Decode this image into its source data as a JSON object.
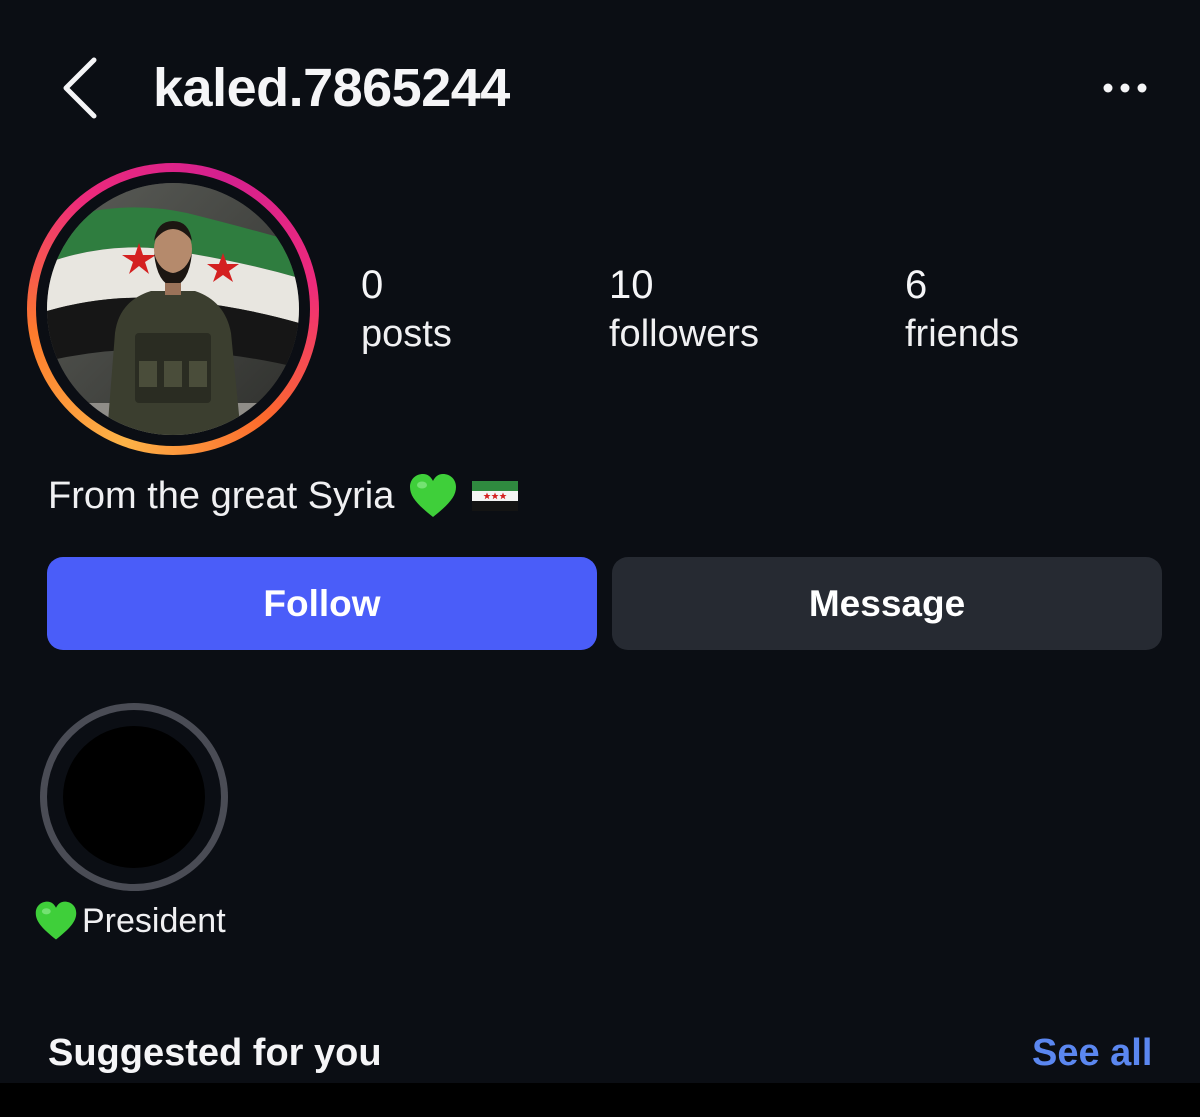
{
  "header": {
    "username": "kaled.7865244",
    "back_icon": "chevron-left-icon",
    "more_icon": "more-horizontal-icon"
  },
  "stats": [
    {
      "value": "0",
      "label": "posts"
    },
    {
      "value": "10",
      "label": "followers"
    },
    {
      "value": "6",
      "label": "friends"
    }
  ],
  "bio": {
    "text": "From the great Syria",
    "emoji": [
      "green-heart-icon",
      "syrian-revolution-flag-icon"
    ]
  },
  "actions": {
    "follow_label": "Follow",
    "message_label": "Message"
  },
  "highlights": [
    {
      "label": "President",
      "emoji": "green-heart-icon"
    }
  ],
  "suggested": {
    "title": "Suggested for you",
    "see_all_label": "See all"
  },
  "colors": {
    "background": "#0b0e14",
    "follow_button": "#4a5df9",
    "message_button": "#262a32",
    "link": "#5b87f0"
  }
}
